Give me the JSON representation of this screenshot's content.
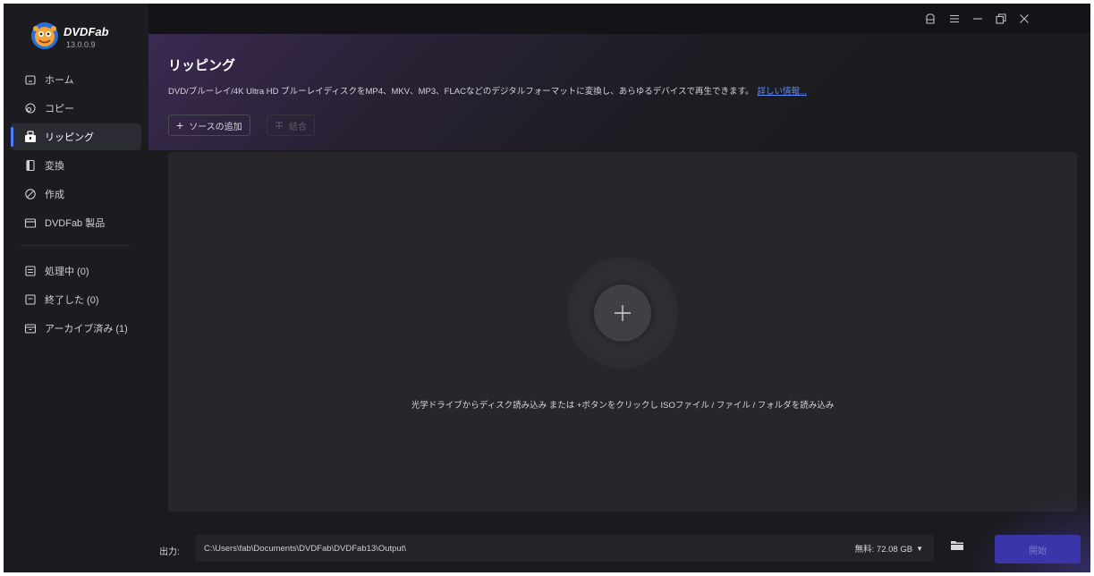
{
  "app": {
    "brand": "DVDFab",
    "version": "13.0.0.9"
  },
  "sidebar": {
    "items": [
      {
        "label": "ホーム",
        "icon": "home-icon"
      },
      {
        "label": "コピー",
        "icon": "copy-icon"
      },
      {
        "label": "リッピング",
        "icon": "ripper-icon",
        "active": true
      },
      {
        "label": "変換",
        "icon": "convert-icon"
      },
      {
        "label": "作成",
        "icon": "create-icon"
      },
      {
        "label": "DVDFab 製品",
        "icon": "products-icon"
      }
    ],
    "queue": [
      {
        "label": "処理中 (0)",
        "icon": "processing-icon"
      },
      {
        "label": "終了した (0)",
        "icon": "finished-icon"
      },
      {
        "label": "アーカイブ済み (1)",
        "icon": "archive-icon"
      }
    ]
  },
  "titlebar": {
    "icons": [
      "skin-icon",
      "menu-icon",
      "minimize-icon",
      "restore-icon",
      "close-icon"
    ]
  },
  "main": {
    "title": "リッピング",
    "description": "DVD/ブルーレイ/4K Ultra HD ブルーレイディスクをMP4、MKV、MP3、FLACなどのデジタルフォーマットに変換し、あらゆるデバイスで再生できます。",
    "more_link": "詳しい情報...",
    "add_source_label": "ソースの追加",
    "merge_label": "結合",
    "drop_hint": "光学ドライブからディスク読み込み または +ボタンをクリックし ISOファイル / ファイル / フォルダを読み込み"
  },
  "footer": {
    "output_label": "出力:",
    "output_path": "C:\\Users\\fab\\Documents\\DVDFab\\DVDFab13\\Output\\",
    "free_space": "無料: 72.08 GB",
    "start_label": "開始"
  },
  "colors": {
    "accent": "#4d7cff",
    "start_button": "#3a35a8",
    "link": "#5f8dff"
  }
}
